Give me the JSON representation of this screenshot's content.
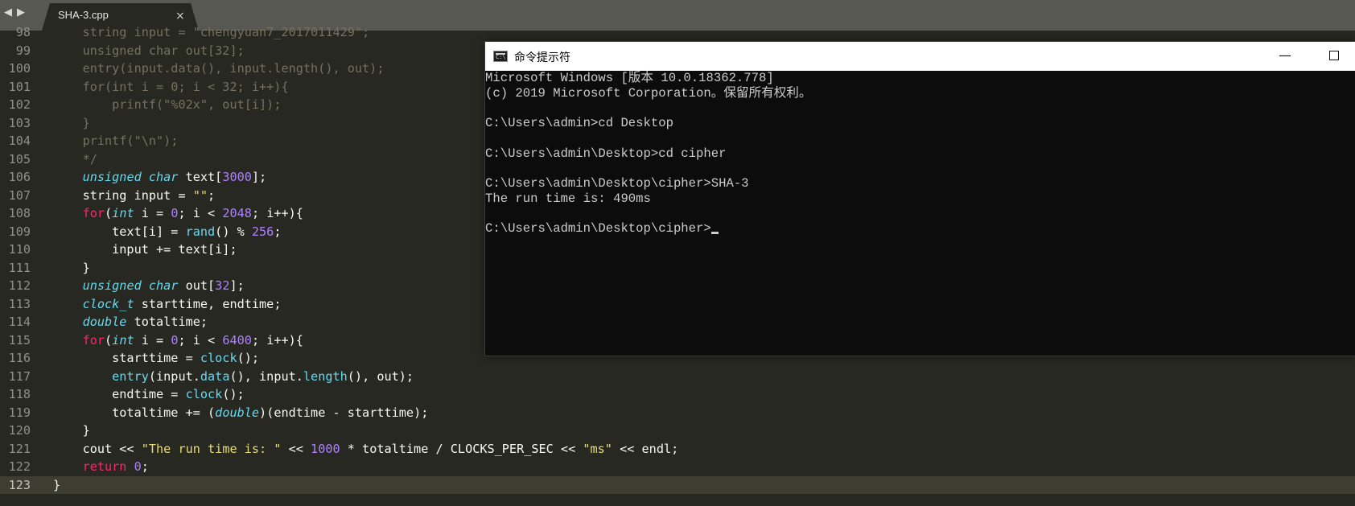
{
  "tab_bar": {
    "back_arrow": "◀",
    "forward_arrow": "▶",
    "active_tab": {
      "title": "SHA-3.cpp",
      "close_glyph": "×"
    }
  },
  "editor": {
    "active_line": "123",
    "lines": [
      {
        "num": "98",
        "tokens": [
          {
            "t": "    string input = \"chengyuan7_2017011429\";",
            "c": "cm"
          }
        ]
      },
      {
        "num": "99",
        "tokens": [
          {
            "t": "    unsigned char out[32];",
            "c": "cm"
          }
        ]
      },
      {
        "num": "100",
        "tokens": [
          {
            "t": "    entry(input.data(), input.length(), out);",
            "c": "cm"
          }
        ]
      },
      {
        "num": "101",
        "tokens": [
          {
            "t": "    for(int i = 0; i < 32; i++){",
            "c": "cm"
          }
        ]
      },
      {
        "num": "102",
        "tokens": [
          {
            "t": "        printf(\"%02x\", out[i]);",
            "c": "cm"
          }
        ]
      },
      {
        "num": "103",
        "tokens": [
          {
            "t": "    }",
            "c": "cm"
          }
        ]
      },
      {
        "num": "104",
        "tokens": [
          {
            "t": "    printf(\"\\n\");",
            "c": "cm"
          }
        ]
      },
      {
        "num": "105",
        "tokens": [
          {
            "t": "    */",
            "c": "cm"
          }
        ]
      },
      {
        "num": "106",
        "tokens": [
          {
            "t": "    "
          },
          {
            "t": "unsigned char",
            "c": "ty"
          },
          {
            "t": " text["
          },
          {
            "t": "3000",
            "c": "nm"
          },
          {
            "t": "];"
          }
        ]
      },
      {
        "num": "107",
        "tokens": [
          {
            "t": "    string input = "
          },
          {
            "t": "\"\"",
            "c": "st"
          },
          {
            "t": ";"
          }
        ]
      },
      {
        "num": "108",
        "tokens": [
          {
            "t": "    "
          },
          {
            "t": "for",
            "c": "kw"
          },
          {
            "t": "("
          },
          {
            "t": "int",
            "c": "ty"
          },
          {
            "t": " i = "
          },
          {
            "t": "0",
            "c": "nm"
          },
          {
            "t": "; i < "
          },
          {
            "t": "2048",
            "c": "nm"
          },
          {
            "t": "; i++){"
          }
        ]
      },
      {
        "num": "109",
        "tokens": [
          {
            "t": "        text[i] = "
          },
          {
            "t": "rand",
            "c": "fn"
          },
          {
            "t": "() % "
          },
          {
            "t": "256",
            "c": "nm"
          },
          {
            "t": ";"
          }
        ]
      },
      {
        "num": "110",
        "tokens": [
          {
            "t": "        input += text[i];"
          }
        ]
      },
      {
        "num": "111",
        "tokens": [
          {
            "t": "    }"
          }
        ]
      },
      {
        "num": "112",
        "tokens": [
          {
            "t": "    "
          },
          {
            "t": "unsigned char",
            "c": "ty"
          },
          {
            "t": " out["
          },
          {
            "t": "32",
            "c": "nm"
          },
          {
            "t": "];"
          }
        ]
      },
      {
        "num": "113",
        "tokens": [
          {
            "t": "    "
          },
          {
            "t": "clock_t",
            "c": "ty"
          },
          {
            "t": " starttime, endtime;"
          }
        ]
      },
      {
        "num": "114",
        "tokens": [
          {
            "t": "    "
          },
          {
            "t": "double",
            "c": "ty"
          },
          {
            "t": " totaltime;"
          }
        ]
      },
      {
        "num": "115",
        "tokens": [
          {
            "t": "    "
          },
          {
            "t": "for",
            "c": "kw"
          },
          {
            "t": "("
          },
          {
            "t": "int",
            "c": "ty"
          },
          {
            "t": " i = "
          },
          {
            "t": "0",
            "c": "nm"
          },
          {
            "t": "; i < "
          },
          {
            "t": "6400",
            "c": "nm"
          },
          {
            "t": "; i++){"
          }
        ]
      },
      {
        "num": "116",
        "tokens": [
          {
            "t": "        starttime = "
          },
          {
            "t": "clock",
            "c": "fn"
          },
          {
            "t": "();"
          }
        ]
      },
      {
        "num": "117",
        "tokens": [
          {
            "t": "        "
          },
          {
            "t": "entry",
            "c": "fn"
          },
          {
            "t": "(input."
          },
          {
            "t": "data",
            "c": "fn"
          },
          {
            "t": "(), input."
          },
          {
            "t": "length",
            "c": "fn"
          },
          {
            "t": "(), out);"
          }
        ]
      },
      {
        "num": "118",
        "tokens": [
          {
            "t": "        endtime = "
          },
          {
            "t": "clock",
            "c": "fn"
          },
          {
            "t": "();"
          }
        ]
      },
      {
        "num": "119",
        "tokens": [
          {
            "t": "        totaltime += ("
          },
          {
            "t": "double",
            "c": "ty"
          },
          {
            "t": ")(endtime - starttime);"
          }
        ]
      },
      {
        "num": "120",
        "tokens": [
          {
            "t": "    }"
          }
        ]
      },
      {
        "num": "121",
        "tokens": [
          {
            "t": "    cout << "
          },
          {
            "t": "\"The run time is: \"",
            "c": "st"
          },
          {
            "t": " << "
          },
          {
            "t": "1000",
            "c": "nm"
          },
          {
            "t": " * totaltime / CLOCKS_PER_SEC << "
          },
          {
            "t": "\"ms\"",
            "c": "st"
          },
          {
            "t": " << endl;"
          }
        ]
      },
      {
        "num": "122",
        "tokens": [
          {
            "t": "    "
          },
          {
            "t": "return",
            "c": "kw"
          },
          {
            "t": " "
          },
          {
            "t": "0",
            "c": "nm"
          },
          {
            "t": ";"
          }
        ]
      },
      {
        "num": "123",
        "tokens": [
          {
            "t": "}"
          }
        ]
      }
    ]
  },
  "cmd_window": {
    "title": "命令提示符",
    "icon_prompt": "C:\\",
    "minimize_glyph": "—",
    "lines": [
      "Microsoft Windows [版本 10.0.18362.778]",
      "(c) 2019 Microsoft Corporation。保留所有权利。",
      "",
      "C:\\Users\\admin>cd Desktop",
      "",
      "C:\\Users\\admin\\Desktop>cd cipher",
      "",
      "C:\\Users\\admin\\Desktop\\cipher>SHA-3",
      "The run time is: 490ms",
      "",
      "C:\\Users\\admin\\Desktop\\cipher>"
    ]
  },
  "colors": {
    "editor_bg": "#272822",
    "comment": "#75715e",
    "keyword": "#f92672",
    "type": "#66d9ef",
    "number": "#ae81ff",
    "string": "#e6db74",
    "console_bg": "#0c0c0c",
    "console_text": "#cccccc"
  }
}
